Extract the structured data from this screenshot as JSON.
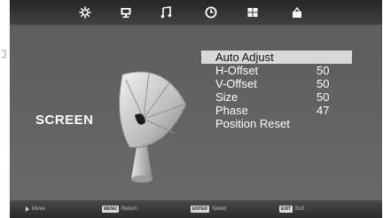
{
  "tabs": [
    {
      "name": "Picture",
      "icon": "gear-icon"
    },
    {
      "name": "Screen",
      "icon": "monitor-icon"
    },
    {
      "name": "Audio",
      "icon": "music-note-icon"
    },
    {
      "name": "Time",
      "icon": "clock-icon"
    },
    {
      "name": "Options",
      "icon": "grid-icon"
    },
    {
      "name": "Lock",
      "icon": "lock-icon"
    }
  ],
  "screen": {
    "title": "SCREEN",
    "illustration": "satellite-dish-icon"
  },
  "menu": {
    "items": [
      {
        "label": "Auto Adjust",
        "value": ""
      },
      {
        "label": "H-Offset",
        "value": "50"
      },
      {
        "label": "V-Offset",
        "value": "50"
      },
      {
        "label": "Size",
        "value": "50"
      },
      {
        "label": "Phase",
        "value": "47"
      },
      {
        "label": "Position Reset",
        "value": ""
      }
    ],
    "selected_index": 0
  },
  "footer": {
    "move_label": "Move",
    "return_key": "MENU",
    "return_label": "Return",
    "select_key": "ENTER",
    "select_label": "Select",
    "exit_key": "EXIT",
    "exit_label": "Exit"
  },
  "colors": {
    "selected_bg": "#d8d8d8",
    "menu_text": "#ffffff"
  }
}
